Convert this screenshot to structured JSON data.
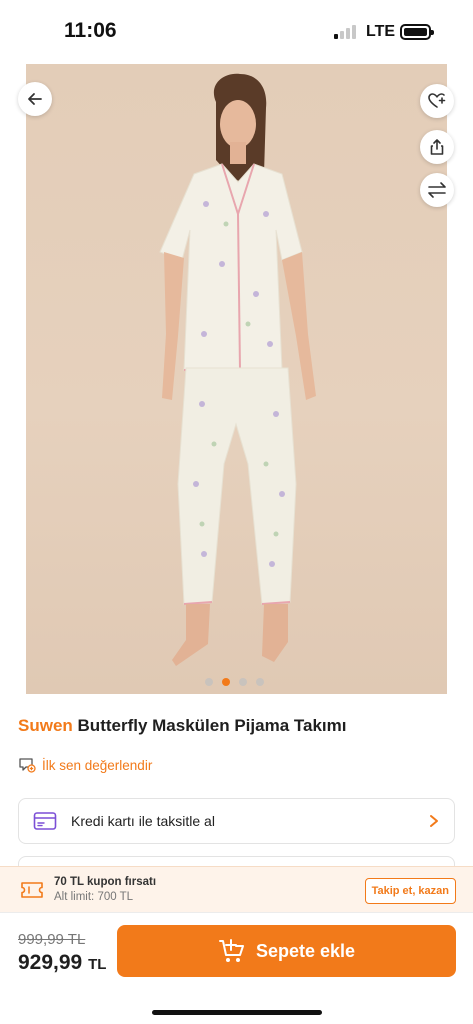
{
  "status": {
    "time": "11:06",
    "network": "LTE"
  },
  "gallery": {
    "dot_count": 4,
    "active_index": 1
  },
  "product": {
    "brand": "Suwen",
    "name": "Butterfly Maskülen Pijama Takımı",
    "review_link": "İlk sen değerlendir"
  },
  "installment": {
    "label": "Kredi kartı ile taksitle al"
  },
  "coupon": {
    "title": "70 TL kupon fırsatı",
    "limit": "Alt limit: 700 TL",
    "button": "Takip et, kazan"
  },
  "price": {
    "old": "999,99 TL",
    "new": "929,99",
    "currency": "TL"
  },
  "cart": {
    "button_label": "Sepete ekle"
  },
  "colors": {
    "accent": "#f27a1a",
    "purple_icon": "#7b4fd6"
  },
  "icons": [
    "back-arrow-icon",
    "heart-icon",
    "share-icon",
    "compare-arrows-icon",
    "review-icon",
    "card-icon",
    "chevron-right-icon",
    "coupon-icon",
    "cart-plus-icon"
  ]
}
